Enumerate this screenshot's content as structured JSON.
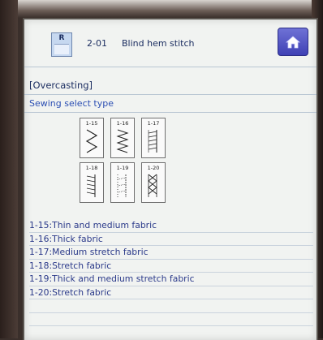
{
  "header": {
    "pattern_number": "2-01",
    "pattern_name": "Blind hem stitch",
    "code_icon_letter": "R",
    "home_icon": "home-icon"
  },
  "section": {
    "title": "[Overcasting]",
    "subtitle": "Sewing select type"
  },
  "stitches": [
    {
      "code": "1-15"
    },
    {
      "code": "1-16"
    },
    {
      "code": "1-17"
    },
    {
      "code": "1-18"
    },
    {
      "code": "1-19"
    },
    {
      "code": "1-20"
    }
  ],
  "descriptions": [
    "1-15:Thin and medium fabric",
    "1-16:Thick fabric",
    "1-17:Medium stretch fabric",
    "1-18:Stretch fabric",
    "1-19:Thick and medium stretch fabric",
    "1-20:Stretch fabric"
  ],
  "colors": {
    "text_dark_blue": "#1c2e61",
    "text_blue": "#2c4fb3",
    "home_button": "#4f52c7"
  }
}
